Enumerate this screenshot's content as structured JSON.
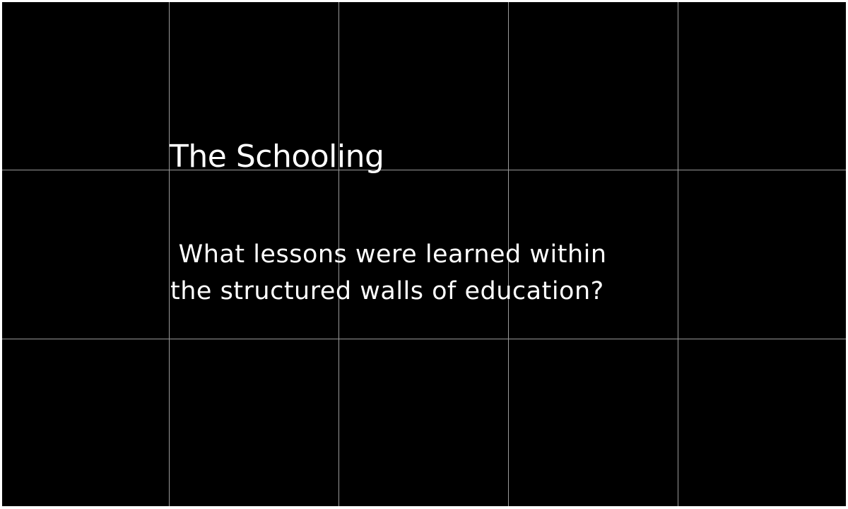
{
  "slide": {
    "title": "The Schooling",
    "question_lines": [
      " What lessons were learned within",
      "the structured walls of education?"
    ]
  },
  "colors": {
    "background": "#000000",
    "text": "#ffffff",
    "grid": "#9a9a9a",
    "border": "#ffffff"
  }
}
